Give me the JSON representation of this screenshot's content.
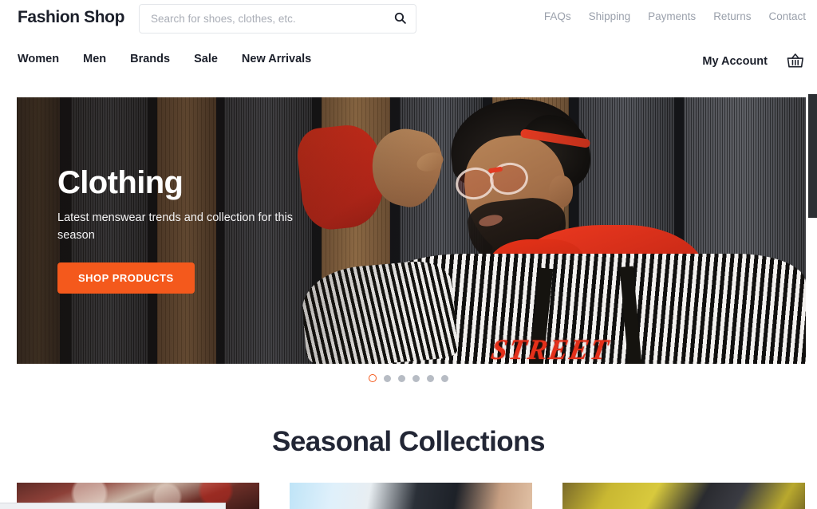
{
  "header": {
    "logo": "Fashion Shop",
    "search": {
      "placeholder": "Search for shoes, clothes, etc.",
      "value": "",
      "icon": "search-icon"
    },
    "utility_links": [
      "FAQs",
      "Shipping",
      "Payments",
      "Returns",
      "Contact"
    ]
  },
  "nav": {
    "items": [
      "Women",
      "Men",
      "Brands",
      "Sale",
      "New Arrivals"
    ],
    "account_label": "My Account",
    "cart_icon": "shopping-basket-icon"
  },
  "hero": {
    "title": "Clothing",
    "subtitle": "Latest menswear trends and collection for this season",
    "cta_label": "SHOP PRODUCTS",
    "cta_color": "#f4591c",
    "graphic_print": "STREET",
    "alt": "Man in striped hoodie with red hood and red glasses against wooden planks"
  },
  "carousel": {
    "total_slides": 6,
    "active_index": 0,
    "active_color": "#f4591c",
    "inactive_color": "#b7bcc4"
  },
  "seasonal": {
    "title": "Seasonal Collections",
    "cards": [
      {
        "name": "collection-card-1"
      },
      {
        "name": "collection-card-2"
      },
      {
        "name": "collection-card-3"
      }
    ]
  }
}
